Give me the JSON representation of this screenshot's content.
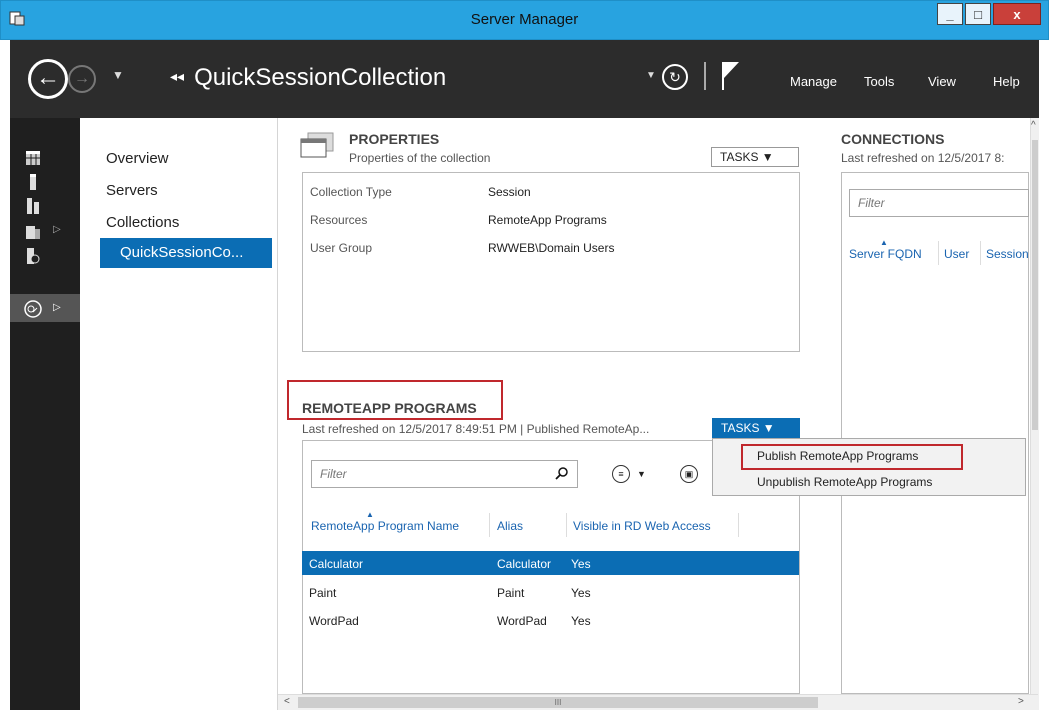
{
  "window": {
    "title": "Server Manager",
    "min": "_",
    "max": "□",
    "close": "x"
  },
  "header": {
    "breadcrumb": "QuickSessionCollection",
    "menu": {
      "manage": "Manage",
      "tools": "Tools",
      "view": "View",
      "help": "Help"
    }
  },
  "nav": {
    "items": [
      "Overview",
      "Servers",
      "Collections",
      "QuickSessionCo..."
    ]
  },
  "properties": {
    "title": "PROPERTIES",
    "subtitle": "Properties of the collection",
    "tasks": "TASKS ▼",
    "rows": [
      {
        "key": "Collection Type",
        "value": "Session"
      },
      {
        "key": "Resources",
        "value": "RemoteApp Programs"
      },
      {
        "key": "User Group",
        "value": "RWWEB\\Domain Users"
      }
    ]
  },
  "connections": {
    "title": "CONNECTIONS",
    "subtitle": "Last refreshed on 12/5/2017 8:",
    "filter_placeholder": "Filter",
    "columns": [
      "Server FQDN",
      "User",
      "Session"
    ]
  },
  "remoteapp": {
    "title": "REMOTEAPP PROGRAMS",
    "subtitle": "Last refreshed on 12/5/2017 8:49:51 PM | Published RemoteAp...",
    "tasks": "TASKS ▼",
    "filter_placeholder": "Filter",
    "columns": [
      "RemoteApp Program Name",
      "Alias",
      "Visible in RD Web Access"
    ],
    "rows": [
      {
        "name": "Calculator",
        "alias": "Calculator",
        "visible": "Yes",
        "selected": true
      },
      {
        "name": "Paint",
        "alias": "Paint",
        "visible": "Yes",
        "selected": false
      },
      {
        "name": "WordPad",
        "alias": "WordPad",
        "visible": "Yes",
        "selected": false
      }
    ]
  },
  "tasks_menu": {
    "items": [
      "Publish RemoteApp Programs",
      "Unpublish RemoteApp Programs"
    ]
  },
  "scroll": {
    "h_thumb": "III"
  },
  "colors": {
    "accent": "#0b6db4",
    "titlebar": "#28a3e0",
    "highlight_box": "#c0282d"
  }
}
